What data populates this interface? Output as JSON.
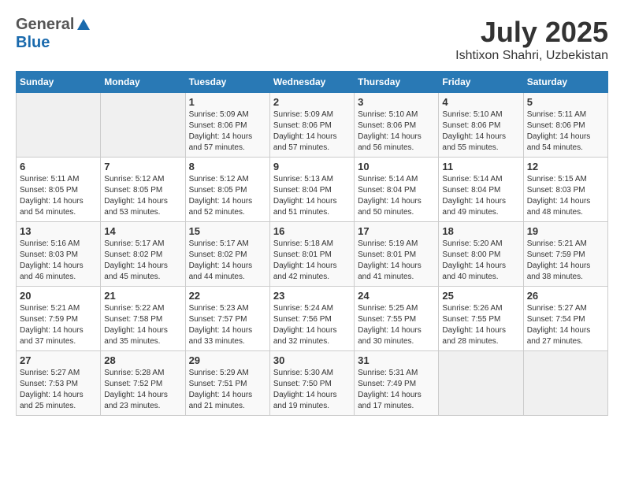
{
  "header": {
    "logo_general": "General",
    "logo_blue": "Blue",
    "month_year": "July 2025",
    "location": "Ishtixon Shahri, Uzbekistan"
  },
  "calendar": {
    "days_of_week": [
      "Sunday",
      "Monday",
      "Tuesday",
      "Wednesday",
      "Thursday",
      "Friday",
      "Saturday"
    ],
    "weeks": [
      [
        {
          "day": "",
          "sunrise": "",
          "sunset": "",
          "daylight": "",
          "empty": true
        },
        {
          "day": "",
          "sunrise": "",
          "sunset": "",
          "daylight": "",
          "empty": true
        },
        {
          "day": "1",
          "sunrise": "Sunrise: 5:09 AM",
          "sunset": "Sunset: 8:06 PM",
          "daylight": "Daylight: 14 hours and 57 minutes.",
          "empty": false
        },
        {
          "day": "2",
          "sunrise": "Sunrise: 5:09 AM",
          "sunset": "Sunset: 8:06 PM",
          "daylight": "Daylight: 14 hours and 57 minutes.",
          "empty": false
        },
        {
          "day": "3",
          "sunrise": "Sunrise: 5:10 AM",
          "sunset": "Sunset: 8:06 PM",
          "daylight": "Daylight: 14 hours and 56 minutes.",
          "empty": false
        },
        {
          "day": "4",
          "sunrise": "Sunrise: 5:10 AM",
          "sunset": "Sunset: 8:06 PM",
          "daylight": "Daylight: 14 hours and 55 minutes.",
          "empty": false
        },
        {
          "day": "5",
          "sunrise": "Sunrise: 5:11 AM",
          "sunset": "Sunset: 8:06 PM",
          "daylight": "Daylight: 14 hours and 54 minutes.",
          "empty": false
        }
      ],
      [
        {
          "day": "6",
          "sunrise": "Sunrise: 5:11 AM",
          "sunset": "Sunset: 8:05 PM",
          "daylight": "Daylight: 14 hours and 54 minutes.",
          "empty": false
        },
        {
          "day": "7",
          "sunrise": "Sunrise: 5:12 AM",
          "sunset": "Sunset: 8:05 PM",
          "daylight": "Daylight: 14 hours and 53 minutes.",
          "empty": false
        },
        {
          "day": "8",
          "sunrise": "Sunrise: 5:12 AM",
          "sunset": "Sunset: 8:05 PM",
          "daylight": "Daylight: 14 hours and 52 minutes.",
          "empty": false
        },
        {
          "day": "9",
          "sunrise": "Sunrise: 5:13 AM",
          "sunset": "Sunset: 8:04 PM",
          "daylight": "Daylight: 14 hours and 51 minutes.",
          "empty": false
        },
        {
          "day": "10",
          "sunrise": "Sunrise: 5:14 AM",
          "sunset": "Sunset: 8:04 PM",
          "daylight": "Daylight: 14 hours and 50 minutes.",
          "empty": false
        },
        {
          "day": "11",
          "sunrise": "Sunrise: 5:14 AM",
          "sunset": "Sunset: 8:04 PM",
          "daylight": "Daylight: 14 hours and 49 minutes.",
          "empty": false
        },
        {
          "day": "12",
          "sunrise": "Sunrise: 5:15 AM",
          "sunset": "Sunset: 8:03 PM",
          "daylight": "Daylight: 14 hours and 48 minutes.",
          "empty": false
        }
      ],
      [
        {
          "day": "13",
          "sunrise": "Sunrise: 5:16 AM",
          "sunset": "Sunset: 8:03 PM",
          "daylight": "Daylight: 14 hours and 46 minutes.",
          "empty": false
        },
        {
          "day": "14",
          "sunrise": "Sunrise: 5:17 AM",
          "sunset": "Sunset: 8:02 PM",
          "daylight": "Daylight: 14 hours and 45 minutes.",
          "empty": false
        },
        {
          "day": "15",
          "sunrise": "Sunrise: 5:17 AM",
          "sunset": "Sunset: 8:02 PM",
          "daylight": "Daylight: 14 hours and 44 minutes.",
          "empty": false
        },
        {
          "day": "16",
          "sunrise": "Sunrise: 5:18 AM",
          "sunset": "Sunset: 8:01 PM",
          "daylight": "Daylight: 14 hours and 42 minutes.",
          "empty": false
        },
        {
          "day": "17",
          "sunrise": "Sunrise: 5:19 AM",
          "sunset": "Sunset: 8:01 PM",
          "daylight": "Daylight: 14 hours and 41 minutes.",
          "empty": false
        },
        {
          "day": "18",
          "sunrise": "Sunrise: 5:20 AM",
          "sunset": "Sunset: 8:00 PM",
          "daylight": "Daylight: 14 hours and 40 minutes.",
          "empty": false
        },
        {
          "day": "19",
          "sunrise": "Sunrise: 5:21 AM",
          "sunset": "Sunset: 7:59 PM",
          "daylight": "Daylight: 14 hours and 38 minutes.",
          "empty": false
        }
      ],
      [
        {
          "day": "20",
          "sunrise": "Sunrise: 5:21 AM",
          "sunset": "Sunset: 7:59 PM",
          "daylight": "Daylight: 14 hours and 37 minutes.",
          "empty": false
        },
        {
          "day": "21",
          "sunrise": "Sunrise: 5:22 AM",
          "sunset": "Sunset: 7:58 PM",
          "daylight": "Daylight: 14 hours and 35 minutes.",
          "empty": false
        },
        {
          "day": "22",
          "sunrise": "Sunrise: 5:23 AM",
          "sunset": "Sunset: 7:57 PM",
          "daylight": "Daylight: 14 hours and 33 minutes.",
          "empty": false
        },
        {
          "day": "23",
          "sunrise": "Sunrise: 5:24 AM",
          "sunset": "Sunset: 7:56 PM",
          "daylight": "Daylight: 14 hours and 32 minutes.",
          "empty": false
        },
        {
          "day": "24",
          "sunrise": "Sunrise: 5:25 AM",
          "sunset": "Sunset: 7:55 PM",
          "daylight": "Daylight: 14 hours and 30 minutes.",
          "empty": false
        },
        {
          "day": "25",
          "sunrise": "Sunrise: 5:26 AM",
          "sunset": "Sunset: 7:55 PM",
          "daylight": "Daylight: 14 hours and 28 minutes.",
          "empty": false
        },
        {
          "day": "26",
          "sunrise": "Sunrise: 5:27 AM",
          "sunset": "Sunset: 7:54 PM",
          "daylight": "Daylight: 14 hours and 27 minutes.",
          "empty": false
        }
      ],
      [
        {
          "day": "27",
          "sunrise": "Sunrise: 5:27 AM",
          "sunset": "Sunset: 7:53 PM",
          "daylight": "Daylight: 14 hours and 25 minutes.",
          "empty": false
        },
        {
          "day": "28",
          "sunrise": "Sunrise: 5:28 AM",
          "sunset": "Sunset: 7:52 PM",
          "daylight": "Daylight: 14 hours and 23 minutes.",
          "empty": false
        },
        {
          "day": "29",
          "sunrise": "Sunrise: 5:29 AM",
          "sunset": "Sunset: 7:51 PM",
          "daylight": "Daylight: 14 hours and 21 minutes.",
          "empty": false
        },
        {
          "day": "30",
          "sunrise": "Sunrise: 5:30 AM",
          "sunset": "Sunset: 7:50 PM",
          "daylight": "Daylight: 14 hours and 19 minutes.",
          "empty": false
        },
        {
          "day": "31",
          "sunrise": "Sunrise: 5:31 AM",
          "sunset": "Sunset: 7:49 PM",
          "daylight": "Daylight: 14 hours and 17 minutes.",
          "empty": false
        },
        {
          "day": "",
          "sunrise": "",
          "sunset": "",
          "daylight": "",
          "empty": true
        },
        {
          "day": "",
          "sunrise": "",
          "sunset": "",
          "daylight": "",
          "empty": true
        }
      ]
    ]
  }
}
